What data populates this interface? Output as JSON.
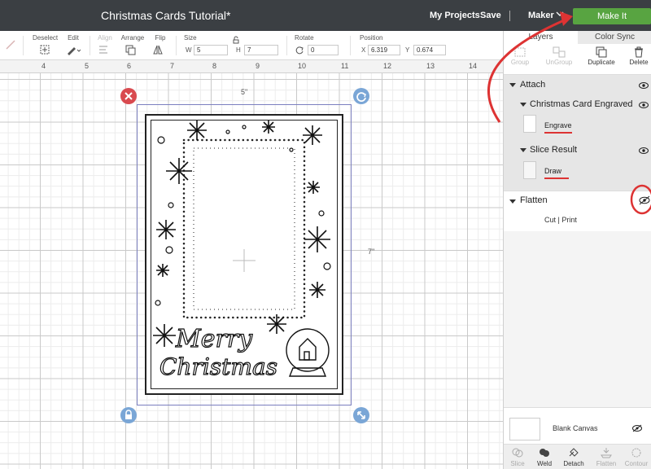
{
  "header": {
    "title": "Christmas Cards Tutorial*",
    "my_projects": "My Projects",
    "save": "Save",
    "separator": "|",
    "machine": "Maker",
    "make_it": "Make It"
  },
  "toolbar": {
    "deselect": "Deselect",
    "edit": "Edit",
    "align": "Align",
    "arrange": "Arrange",
    "flip": "Flip",
    "size": "Size",
    "size_w_prefix": "W",
    "size_w": "5",
    "size_h_prefix": "H",
    "size_h": "7",
    "rotate": "Rotate",
    "rotate_value": "0",
    "position": "Position",
    "pos_x_prefix": "X",
    "pos_x": "6.319",
    "pos_y_prefix": "Y",
    "pos_y": "0.674"
  },
  "ruler": {
    "ticks": [
      "4",
      "5",
      "6",
      "7",
      "8",
      "9",
      "10",
      "11",
      "12",
      "13",
      "14"
    ]
  },
  "canvas": {
    "width_label": "5\"",
    "height_label": "7\"",
    "card_title": "Merry Christmas"
  },
  "panel": {
    "tabs": {
      "layers": "Layers",
      "color_sync": "Color Sync"
    },
    "actions": {
      "group": "Group",
      "ungroup": "UnGroup",
      "duplicate": "Duplicate",
      "delete": "Delete"
    },
    "attach": "Attach",
    "layer_group_1": "Christmas Card Engraved ...",
    "engrave": "Engrave",
    "layer_group_2": "Slice Result",
    "draw": "Draw",
    "flatten": "Flatten",
    "cut_print": "Cut  |  Print",
    "blank_canvas": "Blank Canvas"
  },
  "bottom_tools": {
    "slice": "Slice",
    "weld": "Weld",
    "detach": "Detach",
    "flatten": "Flatten",
    "contour": "Contour"
  },
  "colors": {
    "topbar": "#3b3f43",
    "make_it": "#58a441",
    "annotation_red": "#d33",
    "selection": "#7b7fbf",
    "delete_handle": "#d94a4f",
    "handle_blue": "#7aa6d6"
  }
}
